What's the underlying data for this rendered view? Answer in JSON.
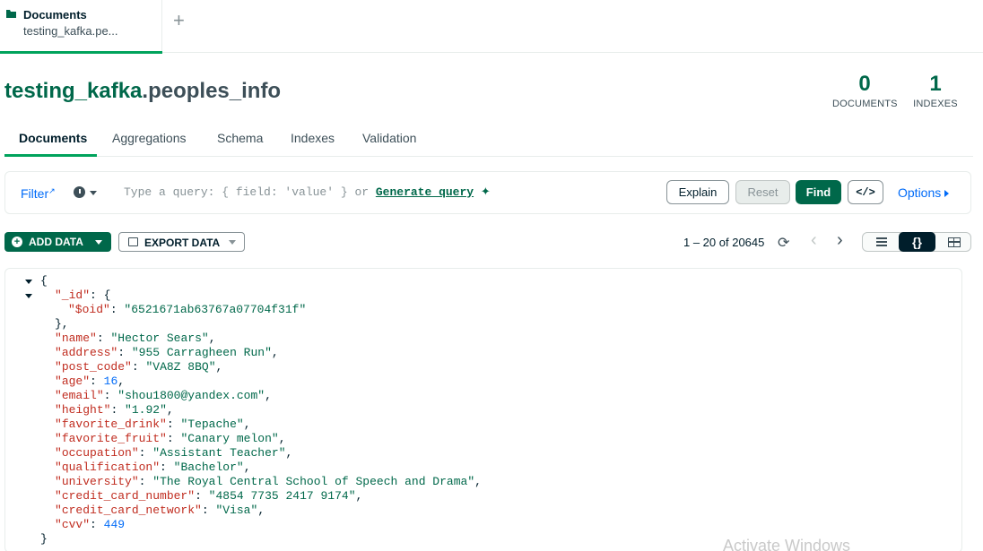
{
  "tab": {
    "title": "Documents",
    "subtitle": "testing_kafka.pe..."
  },
  "header": {
    "db": "testing_kafka",
    "collection": ".peoples_info",
    "documents_count": "0",
    "documents_label": "DOCUMENTS",
    "indexes_count": "1",
    "indexes_label": "INDEXES"
  },
  "subtabs": [
    "Documents",
    "Aggregations",
    "Schema",
    "Indexes",
    "Validation"
  ],
  "query": {
    "filter_label": "Filter",
    "placeholder": "Type a query: { field: 'value' } or",
    "generate_label": "Generate query",
    "explain_label": "Explain",
    "reset_label": "Reset",
    "find_label": "Find",
    "code_label": "</>",
    "options_label": "Options"
  },
  "toolbar": {
    "add_data_label": "ADD DATA",
    "export_data_label": "EXPORT DATA",
    "pagination": "1 – 20 of 20645"
  },
  "document": {
    "oid": "6521671ab63767a07704f31f",
    "fields": [
      {
        "key": "name",
        "value": "Hector Sears",
        "type": "string"
      },
      {
        "key": "address",
        "value": "955 Carragheen Run",
        "type": "string"
      },
      {
        "key": "post_code",
        "value": "VA8Z 8BQ",
        "type": "string"
      },
      {
        "key": "age",
        "value": "16",
        "type": "number"
      },
      {
        "key": "email",
        "value": "shou1800@yandex.com",
        "type": "string"
      },
      {
        "key": "height",
        "value": "1.92",
        "type": "string"
      },
      {
        "key": "favorite_drink",
        "value": "Tepache",
        "type": "string"
      },
      {
        "key": "favorite_fruit",
        "value": "Canary melon",
        "type": "string"
      },
      {
        "key": "occupation",
        "value": "Assistant Teacher",
        "type": "string"
      },
      {
        "key": "qualification",
        "value": "Bachelor",
        "type": "string"
      },
      {
        "key": "university",
        "value": "The Royal Central School of Speech and Drama",
        "type": "string"
      },
      {
        "key": "credit_card_number",
        "value": "4854 7735 2417 9174",
        "type": "string"
      },
      {
        "key": "credit_card_network",
        "value": "Visa",
        "type": "string"
      },
      {
        "key": "cvv",
        "value": "449",
        "type": "number"
      }
    ]
  },
  "watermark": "Activate Windows",
  "colors": {
    "brand_green": "#00684a",
    "accent_green": "#00a35c",
    "link_blue": "#016bf8",
    "key_red": "#c02c1f"
  }
}
